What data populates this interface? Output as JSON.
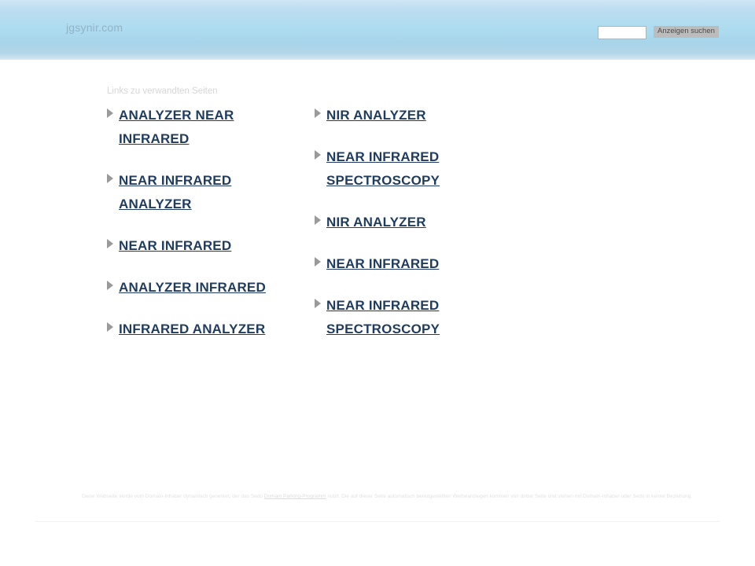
{
  "header": {
    "site_title": "jgsynir.com",
    "search": {
      "input_value": "",
      "input_placeholder": "",
      "button_label": "Anzeigen suchen"
    }
  },
  "main": {
    "related_heading": "Links zu verwandten Seiten",
    "columns": [
      {
        "side": "left",
        "links": [
          {
            "label": "ANALYZER NEAR INFRARED"
          },
          {
            "label": "NEAR INFRARED ANALYZER"
          },
          {
            "label": "NEAR INFRARED"
          },
          {
            "label": "ANALYZER INFRARED"
          },
          {
            "label": "INFRARED ANALYZER"
          }
        ]
      },
      {
        "side": "right",
        "links": [
          {
            "label": "NIR ANALYZER"
          },
          {
            "label": "NEAR INFRARED SPECTROSCOPY"
          },
          {
            "label": "NIR ANALYZER"
          },
          {
            "label": "NEAR INFRARED"
          },
          {
            "label": "NEAR INFRARED SPECTROSCOPY"
          }
        ]
      }
    ]
  },
  "footer": {
    "disclaimer_before_link": "Diese Webseite wurde vom Domain-Inhaber dynamisch generiert, der das Sedo ",
    "disclaimer_link": "Domain Parking-Programm",
    "disclaimer_after_link": " nutzt. Die auf dieser Seite automatisch bereitgestellten Werbeanzeigen kommen von dritter Seite und stehen mit Domain-Inhaber oder Sedo in keiner Beziehung."
  },
  "colors": {
    "header_top": "#cfe6f5",
    "header_mid": "#addcf0",
    "header_bottom": "#dce9f2",
    "link_color": "#1f3c5f",
    "bullet_color": "#9a9a9a",
    "site_title_color": "#93b2c6",
    "heading_color": "#d6d6d6",
    "disclaimer_color": "#e2e2e2",
    "button_bg": "#bcbcbc",
    "page_bg": "#ffffff"
  }
}
